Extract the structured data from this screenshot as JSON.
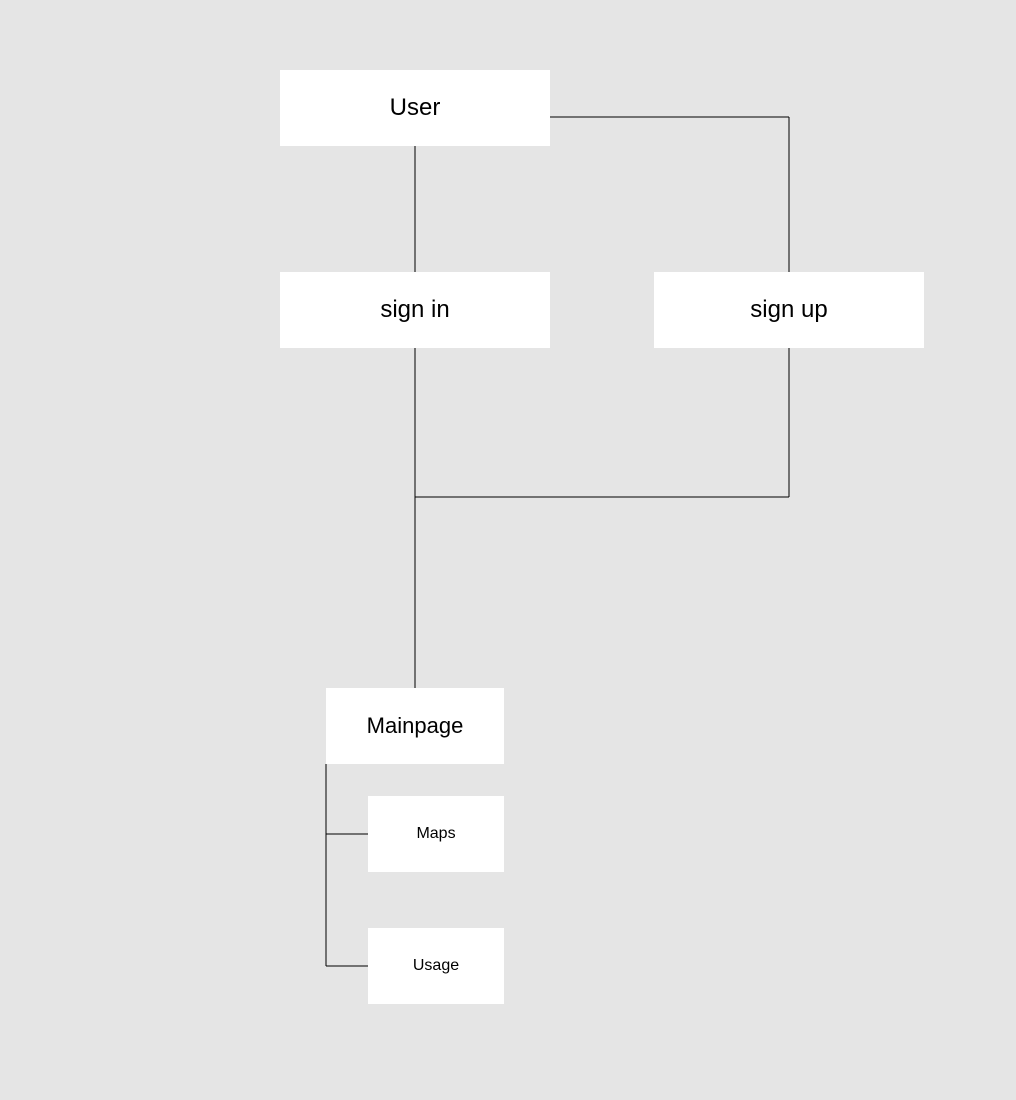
{
  "nodes": {
    "user": {
      "label": "User"
    },
    "signin": {
      "label": "sign in"
    },
    "signup": {
      "label": "sign up"
    },
    "mainpage": {
      "label": "Mainpage"
    },
    "maps": {
      "label": "Maps"
    },
    "usage": {
      "label": "Usage"
    }
  }
}
